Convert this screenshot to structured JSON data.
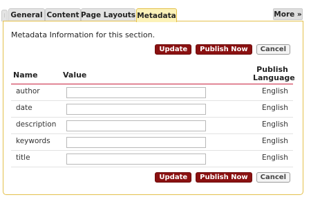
{
  "tabs": [
    {
      "label": "General"
    },
    {
      "label": "Content"
    },
    {
      "label": "Page Layouts"
    },
    {
      "label": "Metadata",
      "active": true
    }
  ],
  "more_label": "More »",
  "intro_text": "Metadata Information for this section.",
  "buttons": {
    "update": "Update",
    "publish": "Publish Now",
    "cancel": "Cancel"
  },
  "table": {
    "headers": {
      "name": "Name",
      "value": "Value",
      "publish_line1": "Publish",
      "publish_line2": "Language"
    },
    "rows": [
      {
        "name": "author",
        "value": "",
        "language": "English"
      },
      {
        "name": "date",
        "value": "",
        "language": "English"
      },
      {
        "name": "description",
        "value": "",
        "language": "English"
      },
      {
        "name": "keywords",
        "value": "",
        "language": "English"
      },
      {
        "name": "title",
        "value": "",
        "language": "English"
      }
    ]
  },
  "colors": {
    "accent_red": "#8a1111",
    "active_tab": "#fcf2b8",
    "panel_border": "#e3c04a",
    "header_rule": "#c81f3b"
  }
}
